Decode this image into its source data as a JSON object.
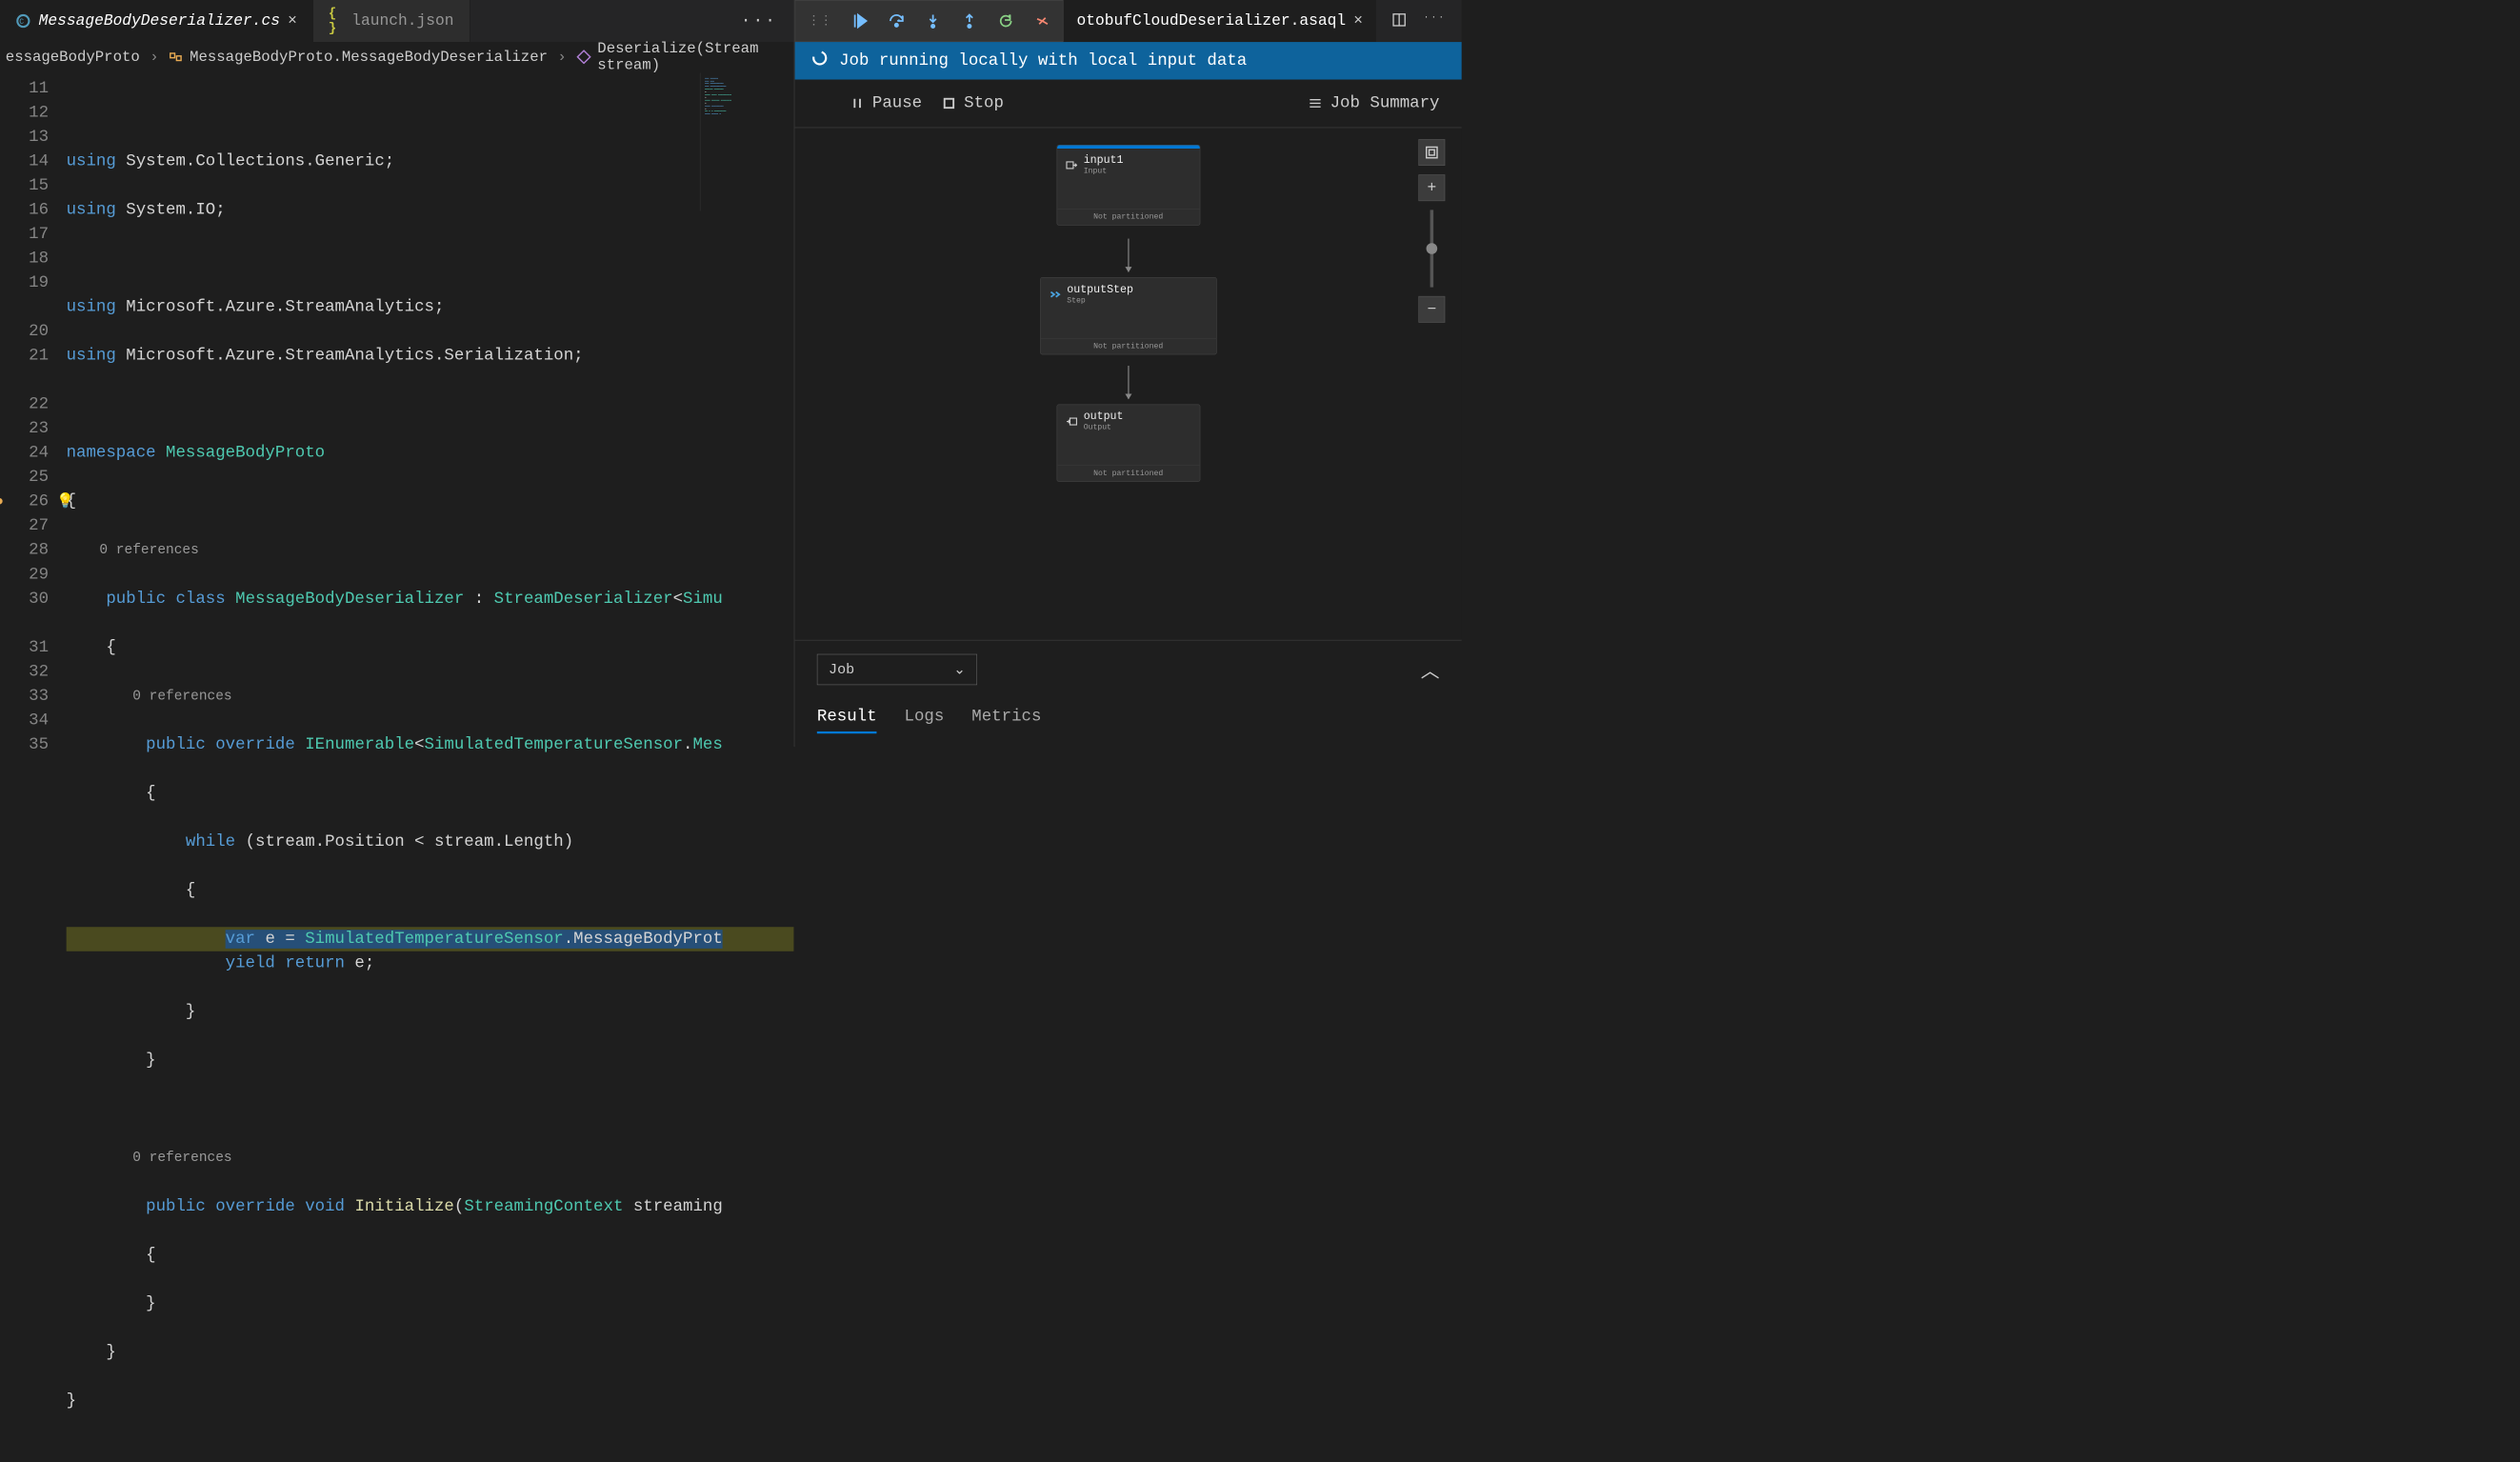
{
  "tabs": {
    "left": [
      {
        "label": "MessageBodyDeserializer.cs",
        "active": true,
        "icon_color": "#519aba"
      },
      {
        "label": "launch.json",
        "active": false,
        "icon_color": "#cbcb41"
      }
    ],
    "right": {
      "label": "otobufCloudDeserializer.asaql"
    }
  },
  "breadcrumb": {
    "a": "essageBodyProto",
    "b": "MessageBodyProto.MessageBodyDeserializer",
    "c": "Deserialize(Stream stream)"
  },
  "lines": {
    "start": 11,
    "end": 35
  },
  "codelens": "0 references",
  "code": {
    "l12": "using System.Collections.Generic;",
    "l13": "using System.IO;",
    "l15": "using Microsoft.Azure.StreamAnalytics;",
    "l16": "using Microsoft.Azure.StreamAnalytics.Serialization;",
    "l18_kw": "namespace",
    "l18_ns": " MessageBodyProto",
    "l20_a": "public",
    "l20_b": "class",
    "l20_c": "MessageBodyDeserializer",
    "l20_d": "StreamDeserializer",
    "l20_e": "Simu",
    "l22_a": "public",
    "l22_b": "override",
    "l22_c": "IEnumerable",
    "l22_d": "SimulatedTemperatureSensor",
    "l22_e": "Mes",
    "l24_a": "while",
    "l24_b": "(stream.Position < stream.Length)",
    "l26_a": "var",
    "l26_b": "e = ",
    "l26_c": "SimulatedTemperatureSensor",
    "l26_d": ".MessageBodyProt",
    "l27_a": "yield",
    "l27_b": "return",
    "l27_c": " e;",
    "l31_a": "public",
    "l31_b": "override",
    "l31_c": "void",
    "l31_d": "Initialize",
    "l31_e": "StreamingContext",
    "l31_f": " streaming"
  },
  "status_banner": "Job running locally with local input data",
  "controls": {
    "pause": "Pause",
    "stop": "Stop",
    "summary": "Job Summary"
  },
  "nodes": {
    "input": {
      "title": "input1",
      "subtitle": "Input",
      "footer": "Not partitioned"
    },
    "step": {
      "title": "outputStep",
      "subtitle": "Step",
      "footer": "Not partitioned"
    },
    "output": {
      "title": "output",
      "subtitle": "Output",
      "footer": "Not partitioned"
    }
  },
  "dropdown": "Job",
  "result_tabs": {
    "result": "Result",
    "logs": "Logs",
    "metrics": "Metrics"
  }
}
